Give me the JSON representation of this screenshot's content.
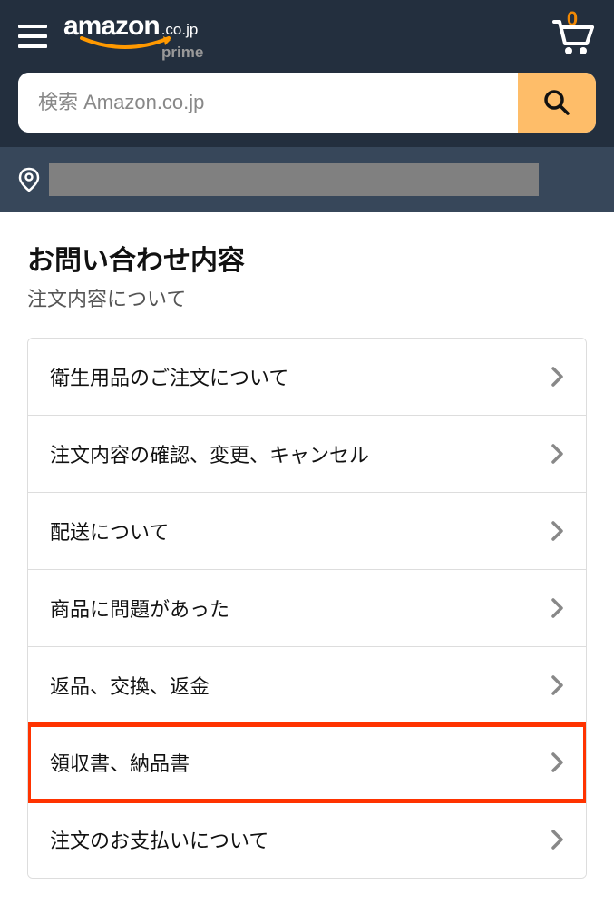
{
  "header": {
    "logo_text": "amazon",
    "logo_suffix": ".co.jp",
    "logo_sub": "prime",
    "cart_count": "0"
  },
  "search": {
    "placeholder": "検索 Amazon.co.jp"
  },
  "page": {
    "title": "お問い合わせ内容",
    "subtitle": "注文内容について"
  },
  "list": {
    "items": [
      {
        "label": "衛生用品のご注文について",
        "highlighted": false
      },
      {
        "label": "注文内容の確認、変更、キャンセル",
        "highlighted": false
      },
      {
        "label": "配送について",
        "highlighted": false
      },
      {
        "label": "商品に問題があった",
        "highlighted": false
      },
      {
        "label": "返品、交換、返金",
        "highlighted": false
      },
      {
        "label": "領収書、納品書",
        "highlighted": true
      },
      {
        "label": "注文のお支払いについて",
        "highlighted": false
      }
    ]
  }
}
